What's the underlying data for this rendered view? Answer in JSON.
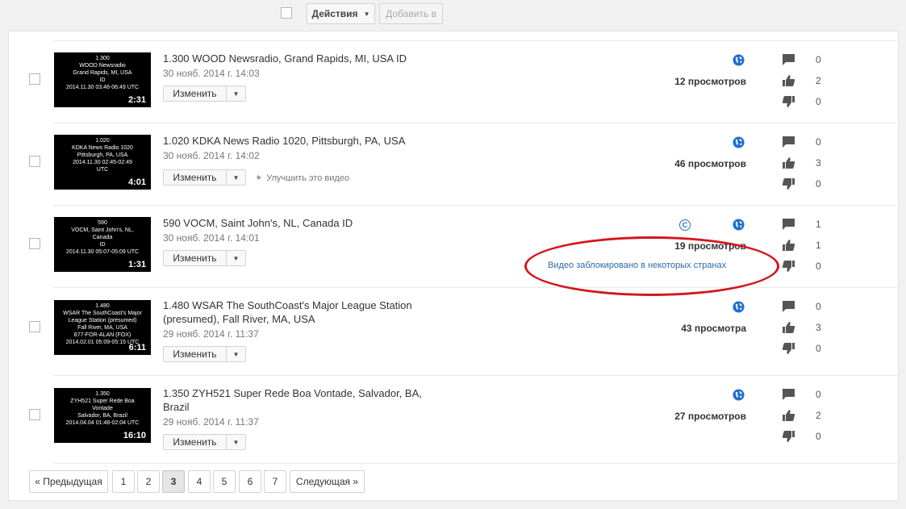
{
  "toolbar": {
    "actions_label": "Действия",
    "add_to_label": "Добавить в"
  },
  "videos": [
    {
      "thumb_lines": [
        "1.300",
        "WOOD Newsradio",
        "Grand Rapids, MI, USA",
        "ID",
        "2014.11.30 03:46-06:49 UTC"
      ],
      "duration": "2:31",
      "title": "1.300 WOOD Newsradio, Grand Rapids, MI, USA ID",
      "date": "30 нояб. 2014 г. 14:03",
      "edit_label": "Изменить",
      "views": "12 просмотров",
      "comments": "0",
      "likes": "2",
      "dislikes": "0"
    },
    {
      "thumb_lines": [
        "1.020",
        "KDKA News Radio 1020",
        "Pittsburgh, PA, USA",
        "2014.11.30 02:45-02:49",
        "UTC"
      ],
      "duration": "4:01",
      "title": "1.020 KDKA News Radio 1020, Pittsburgh, PA, USA",
      "date": "30 нояб. 2014 г. 14:02",
      "edit_label": "Изменить",
      "improve_label": "Улучшить это видео",
      "views": "46 просмотров",
      "comments": "0",
      "likes": "3",
      "dislikes": "0"
    },
    {
      "thumb_lines": [
        "590",
        "VOCM, Saint John's, NL,",
        "Canada",
        "ID",
        "2014.11.30 05:07-05:09 UTC"
      ],
      "duration": "1:31",
      "title": "590 VOCM, Saint John's, NL, Canada ID",
      "date": "30 нояб. 2014 г. 14:01",
      "edit_label": "Изменить",
      "views": "19 просмотров",
      "blocked_label": "Видео заблокировано в некоторых странах",
      "comments": "1",
      "likes": "1",
      "dislikes": "0"
    },
    {
      "thumb_lines": [
        "1.480",
        "WSAR The SouthCoast's Major",
        "League Station (presumed)",
        "Fall River, MA, USA",
        "877-FOR-ALAN (FOX)",
        "2014.02.01 05:09-05:15 UTC"
      ],
      "duration": "6:11",
      "title": "1.480 WSAR The SouthCoast's Major League Station (presumed), Fall River, MA, USA",
      "date": "29 нояб. 2014 г. 11:37",
      "edit_label": "Изменить",
      "views": "43 просмотра",
      "comments": "0",
      "likes": "3",
      "dislikes": "0"
    },
    {
      "thumb_lines": [
        "1.350",
        "ZYH521 Super Rede Boa",
        "Vontade",
        "Salvador, BA, Brazil",
        "2014.04.04 01:48-02:04 UTC"
      ],
      "duration": "16:10",
      "title": "1.350 ZYH521 Super Rede Boa Vontade, Salvador, BA, Brazil",
      "date": "29 нояб. 2014 г. 11:37",
      "edit_label": "Изменить",
      "views": "27 просмотров",
      "comments": "0",
      "likes": "2",
      "dislikes": "0"
    }
  ],
  "pagination": {
    "prev": "« Предыдущая",
    "pages": [
      "1",
      "2",
      "3",
      "4",
      "5",
      "6",
      "7"
    ],
    "current": "3",
    "next": "Следующая »"
  },
  "colors": {
    "accent": "#1f6fd1",
    "annotation": "#d4161c",
    "link": "#2b6aa6"
  }
}
